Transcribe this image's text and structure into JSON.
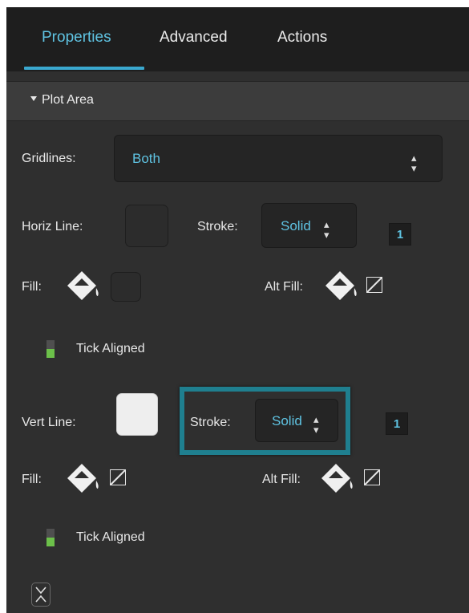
{
  "tabs": [
    {
      "label": "Properties",
      "active": true
    },
    {
      "label": "Advanced",
      "active": false
    },
    {
      "label": "Actions",
      "active": false
    }
  ],
  "section": {
    "title": "Plot Area",
    "expanded": true
  },
  "gridlines": {
    "label": "Gridlines:",
    "value": "Both"
  },
  "horizontal": {
    "line_label": "Horiz Line:",
    "stroke_label": "Stroke:",
    "stroke_value": "Solid",
    "stroke_width": "1",
    "fill_label": "Fill:",
    "alt_fill_label": "Alt Fill:",
    "tick_aligned_label": "Tick Aligned"
  },
  "vertical": {
    "line_label": "Vert Line:",
    "stroke_label": "Stroke:",
    "stroke_value": "Solid",
    "stroke_width": "1",
    "fill_label": "Fill:",
    "alt_fill_label": "Alt Fill:",
    "tick_aligned_label": "Tick Aligned"
  },
  "colors": {
    "accent": "#5fc3e2",
    "panel_bg": "#2f2f2f",
    "tabbar_bg": "#1e1e1e",
    "highlight": "#1f7f8f",
    "toggle_on": "#6cc04a"
  },
  "icons": [
    "paint-bucket-icon",
    "no-fill-icon",
    "updown-arrows-icon",
    "collapse-icon",
    "triangle-down-icon"
  ]
}
